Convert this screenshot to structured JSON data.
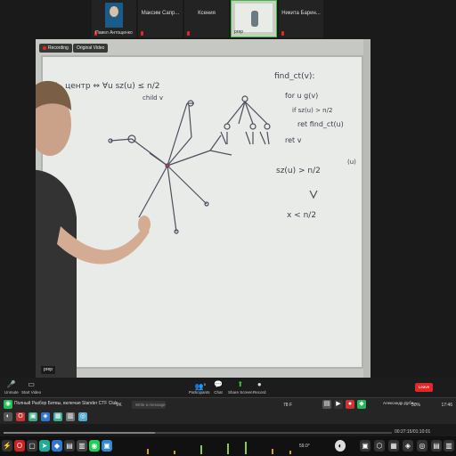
{
  "participants": [
    {
      "name": "Павел Антощенко"
    },
    {
      "name": "Максим Сапр..."
    },
    {
      "name": "Ксения"
    },
    {
      "name": "prep"
    },
    {
      "name": "Никита Барин..."
    }
  ],
  "video": {
    "recording_label": "Recording",
    "original_label": "Original Video",
    "name_tag": "prep"
  },
  "whiteboard": {
    "line1": "V - центр ⇔ ∀u  sz(u) ≤ n/2",
    "line1b": "child v",
    "code": [
      "find_ct(v):",
      "for u  g(v)",
      "if sz(u) > n/2",
      "ret find_ct(u)",
      "ret v"
    ],
    "eq1": "sz(u) > n/2",
    "eq2": "x < n/2",
    "margin_note": "(u)"
  },
  "toolbar": {
    "unmute": "Unmute",
    "start_video": "Start Video",
    "participants": "Participants",
    "participants_count": "5",
    "chat": "Chat",
    "share_screen": "Share Screen",
    "record": "Record",
    "leave": "Leave"
  },
  "taskbar": {
    "tab_title": "Полный Разбор Битвы, включая Slander CTF Club",
    "vk": "VK",
    "message_placeholder": "Write a message...",
    "weather": "78 F",
    "user": "Александр Дуби...",
    "user_status": "online",
    "battery": "30%",
    "clock": "17:46",
    "position": "00:27:15/01:10:01",
    "progress": 0.39
  },
  "dock": {
    "sys_temp": "59.0°"
  }
}
